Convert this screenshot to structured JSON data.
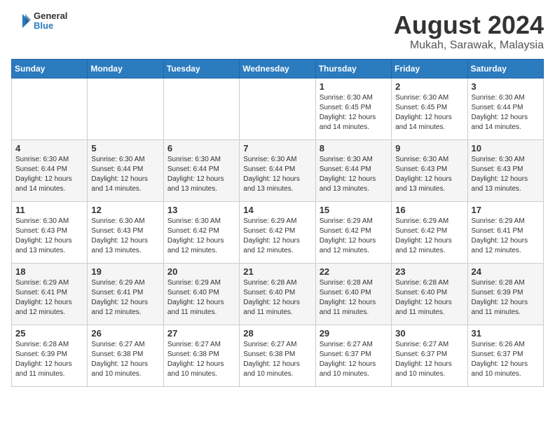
{
  "header": {
    "logo_line1": "General",
    "logo_line2": "Blue",
    "month_year": "August 2024",
    "location": "Mukah, Sarawak, Malaysia"
  },
  "weekdays": [
    "Sunday",
    "Monday",
    "Tuesday",
    "Wednesday",
    "Thursday",
    "Friday",
    "Saturday"
  ],
  "weeks": [
    [
      {
        "day": "",
        "info": ""
      },
      {
        "day": "",
        "info": ""
      },
      {
        "day": "",
        "info": ""
      },
      {
        "day": "",
        "info": ""
      },
      {
        "day": "1",
        "info": "Sunrise: 6:30 AM\nSunset: 6:45 PM\nDaylight: 12 hours\nand 14 minutes."
      },
      {
        "day": "2",
        "info": "Sunrise: 6:30 AM\nSunset: 6:45 PM\nDaylight: 12 hours\nand 14 minutes."
      },
      {
        "day": "3",
        "info": "Sunrise: 6:30 AM\nSunset: 6:44 PM\nDaylight: 12 hours\nand 14 minutes."
      }
    ],
    [
      {
        "day": "4",
        "info": "Sunrise: 6:30 AM\nSunset: 6:44 PM\nDaylight: 12 hours\nand 14 minutes."
      },
      {
        "day": "5",
        "info": "Sunrise: 6:30 AM\nSunset: 6:44 PM\nDaylight: 12 hours\nand 14 minutes."
      },
      {
        "day": "6",
        "info": "Sunrise: 6:30 AM\nSunset: 6:44 PM\nDaylight: 12 hours\nand 13 minutes."
      },
      {
        "day": "7",
        "info": "Sunrise: 6:30 AM\nSunset: 6:44 PM\nDaylight: 12 hours\nand 13 minutes."
      },
      {
        "day": "8",
        "info": "Sunrise: 6:30 AM\nSunset: 6:44 PM\nDaylight: 12 hours\nand 13 minutes."
      },
      {
        "day": "9",
        "info": "Sunrise: 6:30 AM\nSunset: 6:43 PM\nDaylight: 12 hours\nand 13 minutes."
      },
      {
        "day": "10",
        "info": "Sunrise: 6:30 AM\nSunset: 6:43 PM\nDaylight: 12 hours\nand 13 minutes."
      }
    ],
    [
      {
        "day": "11",
        "info": "Sunrise: 6:30 AM\nSunset: 6:43 PM\nDaylight: 12 hours\nand 13 minutes."
      },
      {
        "day": "12",
        "info": "Sunrise: 6:30 AM\nSunset: 6:43 PM\nDaylight: 12 hours\nand 13 minutes."
      },
      {
        "day": "13",
        "info": "Sunrise: 6:30 AM\nSunset: 6:42 PM\nDaylight: 12 hours\nand 12 minutes."
      },
      {
        "day": "14",
        "info": "Sunrise: 6:29 AM\nSunset: 6:42 PM\nDaylight: 12 hours\nand 12 minutes."
      },
      {
        "day": "15",
        "info": "Sunrise: 6:29 AM\nSunset: 6:42 PM\nDaylight: 12 hours\nand 12 minutes."
      },
      {
        "day": "16",
        "info": "Sunrise: 6:29 AM\nSunset: 6:42 PM\nDaylight: 12 hours\nand 12 minutes."
      },
      {
        "day": "17",
        "info": "Sunrise: 6:29 AM\nSunset: 6:41 PM\nDaylight: 12 hours\nand 12 minutes."
      }
    ],
    [
      {
        "day": "18",
        "info": "Sunrise: 6:29 AM\nSunset: 6:41 PM\nDaylight: 12 hours\nand 12 minutes."
      },
      {
        "day": "19",
        "info": "Sunrise: 6:29 AM\nSunset: 6:41 PM\nDaylight: 12 hours\nand 12 minutes."
      },
      {
        "day": "20",
        "info": "Sunrise: 6:29 AM\nSunset: 6:40 PM\nDaylight: 12 hours\nand 11 minutes."
      },
      {
        "day": "21",
        "info": "Sunrise: 6:28 AM\nSunset: 6:40 PM\nDaylight: 12 hours\nand 11 minutes."
      },
      {
        "day": "22",
        "info": "Sunrise: 6:28 AM\nSunset: 6:40 PM\nDaylight: 12 hours\nand 11 minutes."
      },
      {
        "day": "23",
        "info": "Sunrise: 6:28 AM\nSunset: 6:40 PM\nDaylight: 12 hours\nand 11 minutes."
      },
      {
        "day": "24",
        "info": "Sunrise: 6:28 AM\nSunset: 6:39 PM\nDaylight: 12 hours\nand 11 minutes."
      }
    ],
    [
      {
        "day": "25",
        "info": "Sunrise: 6:28 AM\nSunset: 6:39 PM\nDaylight: 12 hours\nand 11 minutes."
      },
      {
        "day": "26",
        "info": "Sunrise: 6:27 AM\nSunset: 6:38 PM\nDaylight: 12 hours\nand 10 minutes."
      },
      {
        "day": "27",
        "info": "Sunrise: 6:27 AM\nSunset: 6:38 PM\nDaylight: 12 hours\nand 10 minutes."
      },
      {
        "day": "28",
        "info": "Sunrise: 6:27 AM\nSunset: 6:38 PM\nDaylight: 12 hours\nand 10 minutes."
      },
      {
        "day": "29",
        "info": "Sunrise: 6:27 AM\nSunset: 6:37 PM\nDaylight: 12 hours\nand 10 minutes."
      },
      {
        "day": "30",
        "info": "Sunrise: 6:27 AM\nSunset: 6:37 PM\nDaylight: 12 hours\nand 10 minutes."
      },
      {
        "day": "31",
        "info": "Sunrise: 6:26 AM\nSunset: 6:37 PM\nDaylight: 12 hours\nand 10 minutes."
      }
    ]
  ]
}
